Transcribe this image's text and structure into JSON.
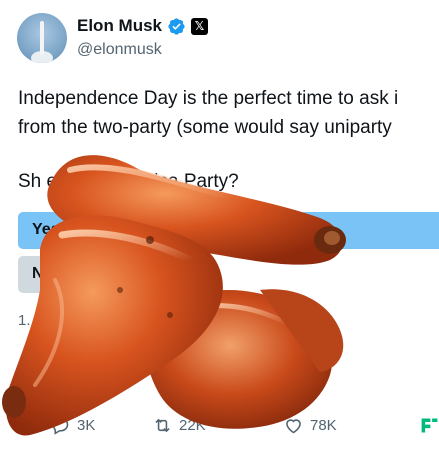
{
  "author": {
    "name": "Elon Musk",
    "handle": "@elonmusk",
    "badge_letter": "𝕏"
  },
  "tweet": {
    "line1": "Independence Day is the perfect time to ask i",
    "line2": "from the two-party (some would say uniparty"
  },
  "poll": {
    "question_visible": "Sh                    ete the America Party?",
    "option_yes": "Yes",
    "option_no": "N",
    "votes_visible": "1."
  },
  "actions": {
    "replies": "3K",
    "reposts": "22K",
    "likes": "78K"
  },
  "colors": {
    "accent_blue": "#1d9bf0",
    "poll_winner": "#7ac3f7",
    "poll_loser": "#cfd9de",
    "muted": "#536471",
    "grok_green": "#00ba7c"
  },
  "icons": [
    "verified-badge-icon",
    "x-logo-icon",
    "reply-icon",
    "repost-icon",
    "like-icon",
    "grok-icon"
  ]
}
